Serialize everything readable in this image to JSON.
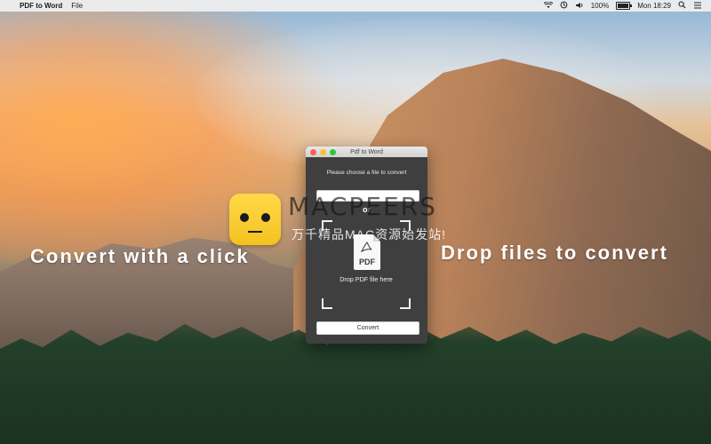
{
  "menubar": {
    "apple_glyph": "",
    "app_name": "PDF to Word",
    "menus": [
      "File"
    ],
    "status": {
      "wifi_icon": "wifi-icon",
      "time_machine_icon": "time-machine-icon",
      "volume_icon": "volume-icon",
      "battery_percent": "100%",
      "battery_level": 1.0,
      "datetime": "Mon 18:29",
      "spotlight_icon": "search-icon",
      "list_icon": "list-icon"
    }
  },
  "overlay": {
    "left_text": "Convert with a click",
    "right_text": "Drop files to convert"
  },
  "watermark": {
    "title": "MACPEERS",
    "subtitle": "万千精品MAC资源始发站!"
  },
  "window": {
    "title": "Pdf to Word",
    "prompt": "Please choose a file to convert",
    "or_label": "or",
    "pdf_label": "PDF",
    "drop_label": "Drop PDF file here",
    "convert_label": "Convert"
  },
  "colors": {
    "window_bg": "#3f3f3f",
    "close": "#ff5f57",
    "minimize": "#febc2e",
    "maximize": "#28c840"
  }
}
